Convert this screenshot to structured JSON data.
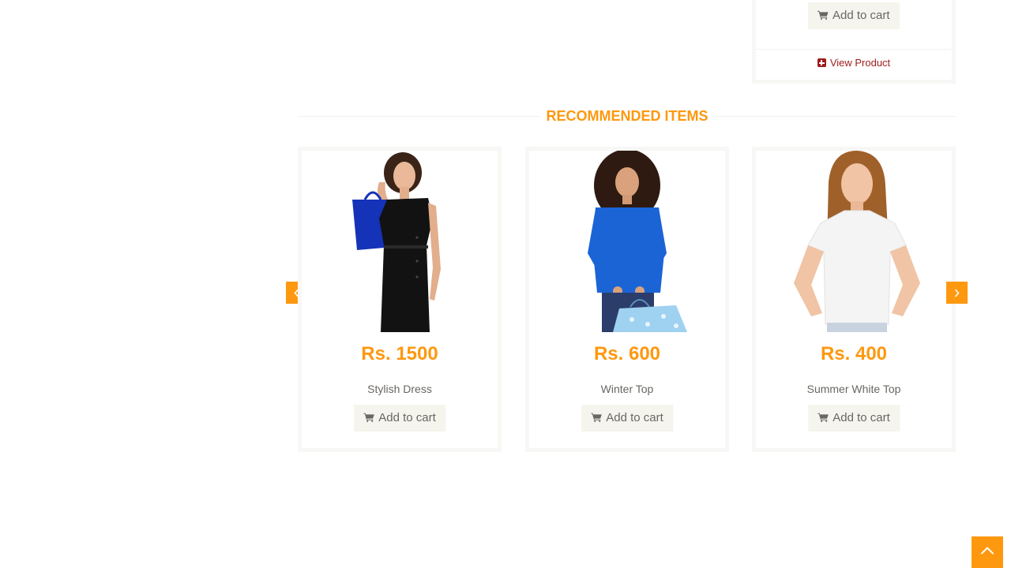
{
  "top_card": {
    "cart_label": "Add to cart",
    "view_product_label": "View Product"
  },
  "section": {
    "title": "RECOMMENDED ITEMS"
  },
  "recommended": [
    {
      "price": "Rs. 1500",
      "name": "Stylish Dress",
      "cart_label": "Add to cart",
      "image": "woman-black-dress-blue-bag"
    },
    {
      "price": "Rs. 600",
      "name": "Winter Top",
      "cart_label": "Add to cart",
      "image": "woman-blue-top-shopping-bag"
    },
    {
      "price": "Rs. 400",
      "name": "Summer White Top",
      "cart_label": "Add to cart",
      "image": "woman-white-top"
    }
  ],
  "carousel": {
    "prev_icon": "chevron-left-icon",
    "next_icon": "chevron-right-icon"
  },
  "scroll_up_icon": "chevron-up-icon",
  "colors": {
    "accent": "#fe980f",
    "view_product": "#9e1b1b",
    "button_bg": "#f5f5ed",
    "text": "#696763"
  }
}
